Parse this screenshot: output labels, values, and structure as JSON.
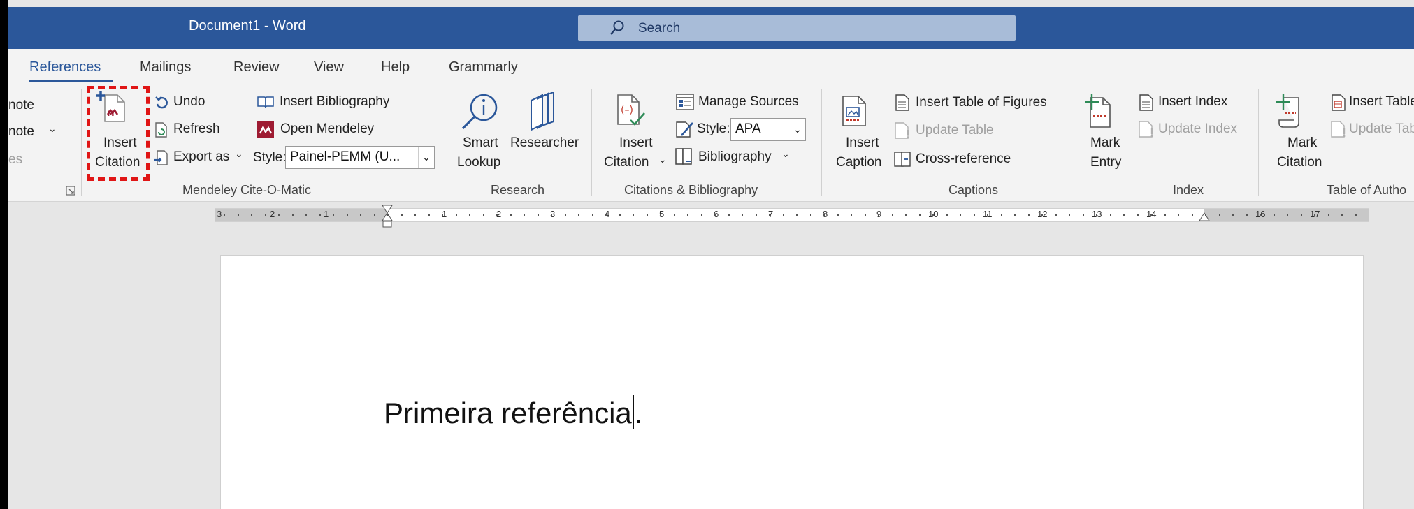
{
  "window": {
    "title": "Document1  -  Word",
    "search_placeholder": "Search",
    "accent_color": "#2b579a"
  },
  "tabs": [
    {
      "label": "References",
      "active": true
    },
    {
      "label": "Mailings"
    },
    {
      "label": "Review"
    },
    {
      "label": "View"
    },
    {
      "label": "Help"
    },
    {
      "label": "Grammarly"
    }
  ],
  "footnotes_partial": {
    "line1": "note",
    "line2": "note",
    "line3": "es"
  },
  "mendeley": {
    "insert_citation_line1": "Insert",
    "insert_citation_line2": "Citation",
    "undo": "Undo",
    "refresh": "Refresh",
    "export_as": "Export as",
    "insert_bibliography": "Insert Bibliography",
    "open_mendeley": "Open Mendeley",
    "style_label": "Style:",
    "style_value": "Painel-PEMM (U...",
    "group_label": "Mendeley Cite-O-Matic",
    "highlight_color": "#e01515"
  },
  "research": {
    "smart_lookup_line1": "Smart",
    "smart_lookup_line2": "Lookup",
    "researcher": "Researcher",
    "group_label": "Research"
  },
  "citations": {
    "insert_citation_line1": "Insert",
    "insert_citation_line2": "Citation",
    "manage_sources": "Manage Sources",
    "style_label": "Style:",
    "style_value": "APA",
    "bibliography": "Bibliography",
    "group_label": "Citations & Bibliography"
  },
  "captions": {
    "insert_caption_line1": "Insert",
    "insert_caption_line2": "Caption",
    "insert_table_of_figures": "Insert Table of Figures",
    "update_table": "Update Table",
    "cross_reference": "Cross-reference",
    "group_label": "Captions"
  },
  "index": {
    "mark_entry_line1": "Mark",
    "mark_entry_line2": "Entry",
    "insert_index": "Insert Index",
    "update_index": "Update Index",
    "group_label": "Index"
  },
  "authorities": {
    "mark_citation_line1": "Mark",
    "mark_citation_line2": "Citation",
    "insert_table": "Insert Table",
    "update_table": "Update Tab",
    "group_label": "Table of Autho"
  },
  "ruler": {
    "left_numbers": [
      "3",
      "2",
      "1"
    ],
    "right_numbers": [
      "1",
      "2",
      "3",
      "4",
      "5",
      "6",
      "7",
      "8",
      "9",
      "10",
      "11",
      "12",
      "13",
      "14",
      "16",
      "17"
    ]
  },
  "document": {
    "text_before_caret": "Primeira referência",
    "text_after_caret": "."
  }
}
